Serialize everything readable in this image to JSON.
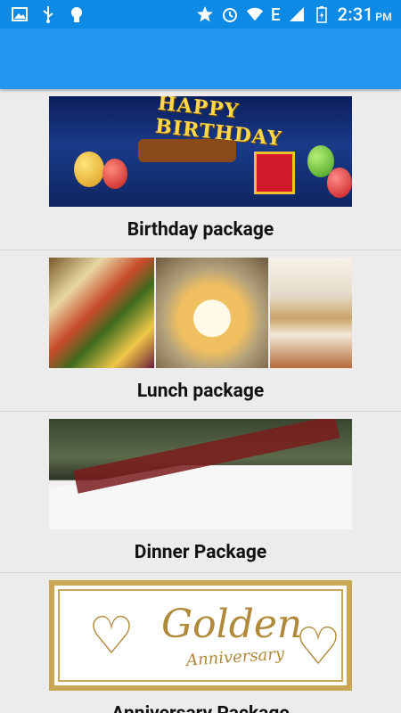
{
  "status_bar": {
    "time": "2:31",
    "ampm": "PM",
    "network": "E",
    "icons": [
      "image-icon",
      "usb-icon",
      "android-icon",
      "star-icon",
      "alarm-icon",
      "wifi-icon",
      "signal-icon",
      "battery-charging-icon"
    ]
  },
  "app_bar": {},
  "packages": [
    {
      "label": "Birthday package",
      "banner_text": "HAPPY BIRTHDAY"
    },
    {
      "label": "Lunch package"
    },
    {
      "label": "Dinner Package"
    },
    {
      "label": "Anniversary Package",
      "banner_text_1": "Golden",
      "banner_text_2": "Anniversary"
    }
  ],
  "colors": {
    "status_bar": "#0d8ae6",
    "app_bar": "#2196f3",
    "background": "#ececec"
  }
}
